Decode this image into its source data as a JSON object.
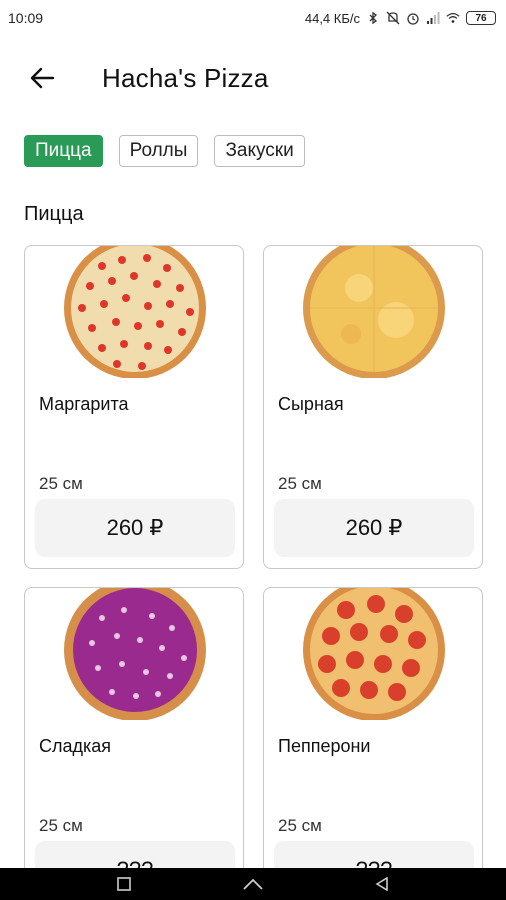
{
  "status_bar": {
    "time": "10:09",
    "network_speed": "44,4 КБ/с",
    "battery": "76"
  },
  "header": {
    "title": "Hacha's Pizza"
  },
  "categories": [
    {
      "label": "Пицца",
      "active": true
    },
    {
      "label": "Роллы",
      "active": false
    },
    {
      "label": "Закуски",
      "active": false
    }
  ],
  "section": {
    "title": "Пицца"
  },
  "products": [
    {
      "name": "Маргарита",
      "size": "25 см",
      "price": "260 ₽",
      "image": "margherita"
    },
    {
      "name": "Сырная",
      "size": "25 см",
      "price": "260 ₽",
      "image": "cheese"
    },
    {
      "name": "Сладкая",
      "size": "25 см",
      "price": "???",
      "image": "sweet"
    },
    {
      "name": "Пепперони",
      "size": "25 см",
      "price": "???",
      "image": "pepperoni"
    }
  ],
  "colors": {
    "accent": "#2a9a57",
    "price_bg": "#f3f3f3",
    "card_border": "#c8c8c8"
  },
  "icons": [
    "back-arrow-icon",
    "bluetooth-icon",
    "mute-icon",
    "alarm-icon",
    "signal-icon",
    "wifi-icon",
    "battery-icon",
    "recent-apps-icon",
    "home-icon",
    "back-nav-icon"
  ]
}
